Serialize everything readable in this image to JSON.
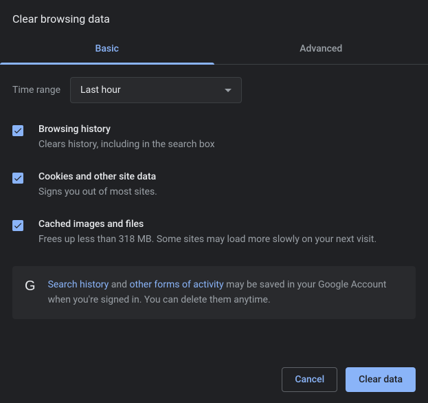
{
  "dialog": {
    "title": "Clear browsing data"
  },
  "tabs": {
    "basic": "Basic",
    "advanced": "Advanced"
  },
  "time_range": {
    "label": "Time range",
    "value": "Last hour"
  },
  "options": [
    {
      "title": "Browsing history",
      "desc": "Clears history, including in the search box",
      "checked": true
    },
    {
      "title": "Cookies and other site data",
      "desc": "Signs you out of most sites.",
      "checked": true
    },
    {
      "title": "Cached images and files",
      "desc": "Frees up less than 318 MB. Some sites may load more slowly on your next visit.",
      "checked": true
    }
  ],
  "info": {
    "link1": "Search history",
    "middle1": " and ",
    "link2": "other forms of activity",
    "rest": " may be saved in your Google Account when you're signed in. You can delete them anytime."
  },
  "buttons": {
    "cancel": "Cancel",
    "clear": "Clear data"
  }
}
